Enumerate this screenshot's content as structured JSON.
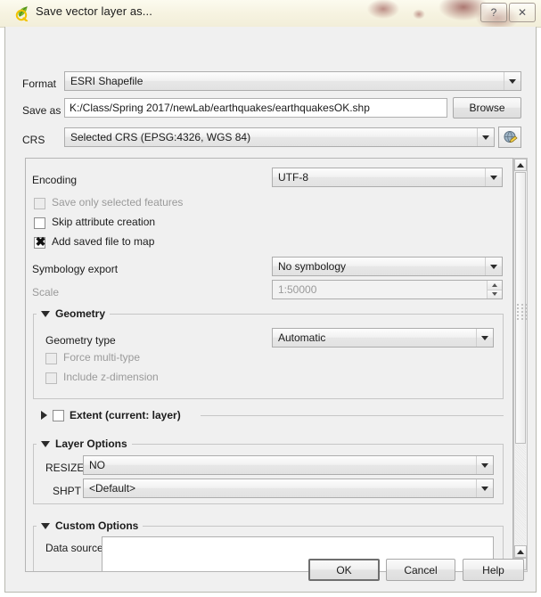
{
  "window": {
    "title": "Save vector layer as...",
    "app_icon": "qgis-leaf-icon",
    "help_button": "?",
    "close_button": "✕"
  },
  "top": {
    "format_label": "Format",
    "format_value": "ESRI Shapefile",
    "save_as_label": "Save as",
    "save_as_value": "K:/Class/Spring 2017/newLab/earthquakes/earthquakesOK.shp",
    "browse_label": "Browse",
    "crs_label": "CRS",
    "crs_value": "Selected CRS (EPSG:4326, WGS 84)",
    "crs_button_icon": "globe-edit-icon"
  },
  "options": {
    "encoding_label": "Encoding",
    "encoding_value": "UTF-8",
    "checkboxes": [
      {
        "label": "Save only selected features",
        "checked": false,
        "enabled": false
      },
      {
        "label": "Skip attribute creation",
        "checked": false,
        "enabled": true
      },
      {
        "label": "Add saved file to map",
        "checked": true,
        "enabled": true
      }
    ],
    "symbology_label": "Symbology export",
    "symbology_value": "No symbology",
    "scale_label": "Scale",
    "scale_value": "1:50000"
  },
  "geometry": {
    "title": "Geometry",
    "expanded": true,
    "type_label": "Geometry type",
    "type_value": "Automatic",
    "force_multi_label": "Force multi-type",
    "include_z_label": "Include z-dimension"
  },
  "extent": {
    "title": "Extent (current: layer)",
    "expanded": false,
    "checked": false
  },
  "layer_options": {
    "title": "Layer Options",
    "rows": [
      {
        "label": "RESIZE",
        "value": "NO"
      },
      {
        "label": "SHPT",
        "value": "<Default>"
      }
    ]
  },
  "custom_options": {
    "title": "Custom Options",
    "data_source_label": "Data source",
    "data_source_value": ""
  },
  "footer": {
    "ok_label": "OK",
    "cancel_label": "Cancel",
    "help_label": "Help"
  }
}
